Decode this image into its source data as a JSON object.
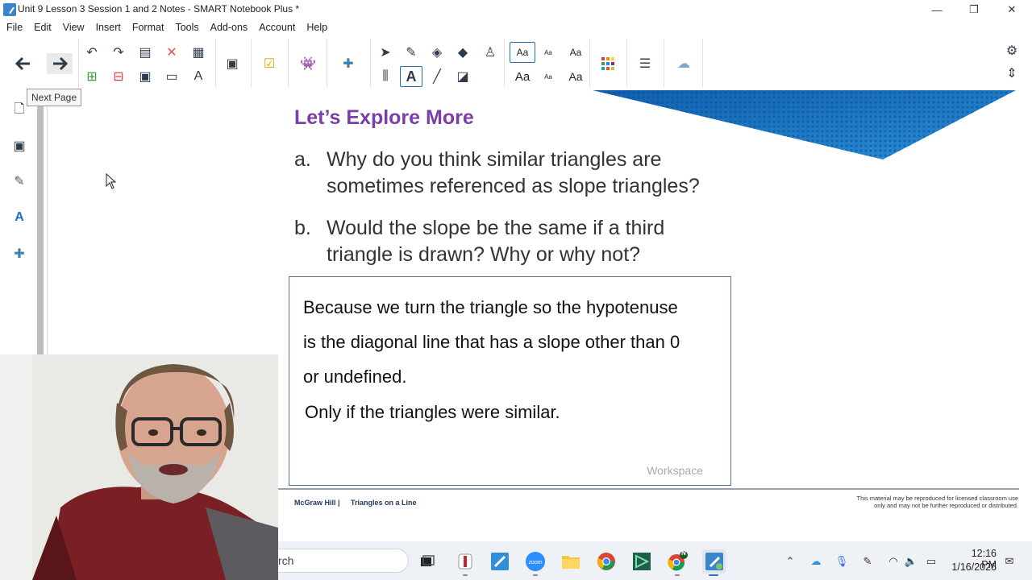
{
  "window": {
    "title": "Unit 9 Lesson 3 Session 1 and 2 Notes - SMART Notebook Plus *",
    "controls": {
      "minimize": "—",
      "maximize": "❐",
      "close": "✕"
    }
  },
  "menu": [
    "File",
    "Edit",
    "View",
    "Insert",
    "Format",
    "Tools",
    "Add-ons",
    "Account",
    "Help"
  ],
  "toolbar": {
    "text_styles": {
      "aa_large": "Aa",
      "aa_small": "Aa",
      "aa_medium": "Aa"
    }
  },
  "tooltip": "Next Page",
  "slide": {
    "heading": "Let’s Explore More",
    "questions": [
      {
        "letter": "a.",
        "line1": "Why do you think similar triangles are",
        "line2": "sometimes referenced as slope triangles?"
      },
      {
        "letter": "b.",
        "line1": "Would the slope be the same if a third",
        "line2": "triangle is drawn? Why or why not?"
      }
    ],
    "answer": {
      "line1": "Because we turn the triangle so the hypotenuse",
      "line2": "is the diagonal line that has a slope other than 0",
      "line3": "or undefined.",
      "line4": "Only if the triangles were similar.",
      "placeholder": "Workspace"
    },
    "footer": {
      "brand": "McGraw Hill  |",
      "title": "Triangles on a Line",
      "notice_line1": "This material may be reproduced for licensed classroom use",
      "notice_line2": "only and may not be further reproduced or distributed."
    }
  },
  "taskbar": {
    "search_text": "rch",
    "notification_badge": "N",
    "clock_time": "12:16 PM",
    "clock_date": "1/16/2026"
  },
  "colors": {
    "heading": "#7b3ea8",
    "accent_blue": "#1f6fb5",
    "banner_blue": "#1d78c4"
  }
}
